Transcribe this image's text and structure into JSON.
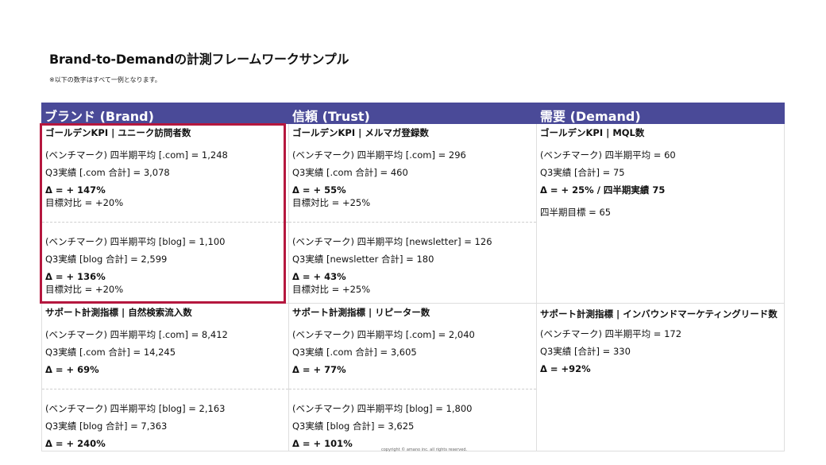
{
  "title": "Brand-to-Demandの計測フレームワークサンプル",
  "note": "※以下の数字はすべて一例となります。",
  "headers": [
    "ブランド (Brand)",
    "信頼 (Trust)",
    "需要 (Demand)"
  ],
  "golden": {
    "brand": {
      "title": "ゴールデンKPI | ユニーク訪問者数",
      "block1": {
        "benchmark": "(ベンチマーク) 四半期平均 [.com] = 1,248",
        "actual": "Q3実績 [.com 合計] = 3,078",
        "delta": "Δ = + 147%",
        "target": "目標対比 = +20%"
      },
      "block2": {
        "benchmark": "(ベンチマーク) 四半期平均 [blog] = 1,100",
        "actual": "Q3実績 [blog 合計] = 2,599",
        "delta": "Δ = + 136%",
        "target": "目標対比 = +20%"
      }
    },
    "trust": {
      "title": "ゴールデンKPI | メルマガ登録数",
      "block1": {
        "benchmark": "(ベンチマーク) 四半期平均 [.com] = 296",
        "actual": "Q3実績 [.com 合計]  = 460",
        "delta": "Δ = + 55%",
        "target": "目標対比 = +25%"
      },
      "block2": {
        "benchmark": "(ベンチマーク) 四半期平均 [newsletter] = 126",
        "actual": "Q3実績 [newsletter 合計]  = 180",
        "delta": "Δ = + 43%",
        "target": "目標対比 = +25%"
      }
    },
    "demand": {
      "title": "ゴールデンKPI | MQL数",
      "benchmark": "(ベンチマーク) 四半期平均 = 60",
      "actual": "Q3実績 [合計] = 75",
      "delta": "Δ = + 25% / 四半期実績 75",
      "target": "四半期目標 = 65"
    }
  },
  "support": {
    "brand": {
      "title": "サポート計測指標 | 自然検索流入数",
      "block1": {
        "benchmark": "(ベンチマーク) 四半期平均 [.com] = 8,412",
        "actual": "Q3実績 [.com 合計] = 14,245",
        "delta": "Δ = + 69%"
      },
      "block2": {
        "benchmark": "(ベンチマーク) 四半期平均 [blog] = 2,163",
        "actual": "Q3実績 [blog 合計] = 7,363",
        "delta": "Δ = + 240%"
      }
    },
    "trust": {
      "title": "サポート計測指標 | リピーター数",
      "block1": {
        "benchmark": "(ベンチマーク) 四半期平均 [.com] = 2,040",
        "actual": "Q3実績 [.com 合計] = 3,605",
        "delta": "Δ = + 77%"
      },
      "block2": {
        "benchmark": "(ベンチマーク) 四半期平均 [blog] = 1,800",
        "actual": "Q3実績 [blog 合計] = 3,625",
        "delta": "Δ = + 101%"
      }
    },
    "demand": {
      "title": "サポート計測指標 | インバウンドマーケティングリード数",
      "benchmark": "(ベンチマーク) 四半期平均 = 172",
      "actual": "Q3実績 [合計]  = 330",
      "delta": "Δ = +92%"
    }
  },
  "copyright": "copyright © amano inc. all rights reserved.",
  "colors": {
    "header_bg": "#4a4a98",
    "highlight_border": "#b5173e"
  }
}
